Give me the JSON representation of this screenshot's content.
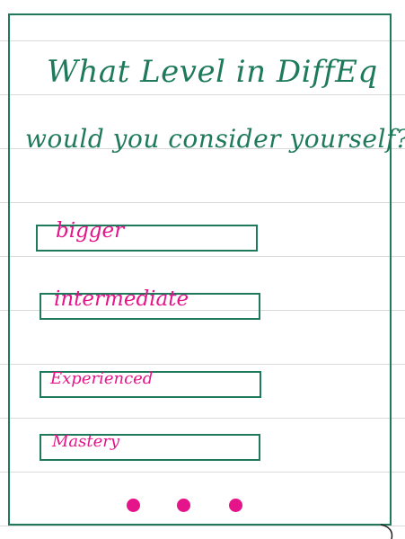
{
  "question": {
    "line1": "What Level in DiffEq",
    "line2": "would you consider yourself?"
  },
  "options": [
    {
      "label": "bigger"
    },
    {
      "label": "intermediate"
    },
    {
      "label": "Experienced"
    },
    {
      "label": "Mastery"
    }
  ],
  "colors": {
    "border": "#1f7a5c",
    "ink_green": "#1f7a5c",
    "ink_pink": "#e6148a",
    "rule_lines": "#d9d9d9"
  }
}
